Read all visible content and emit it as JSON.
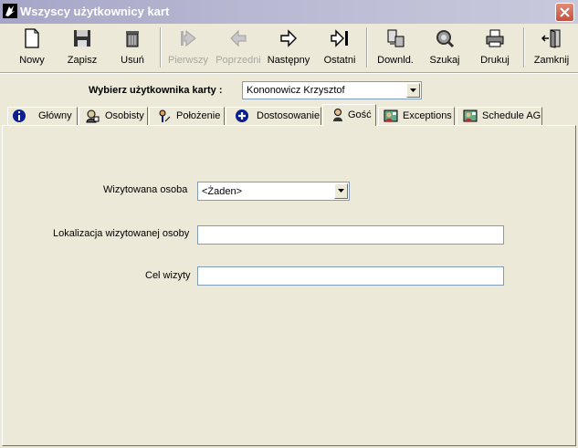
{
  "window": {
    "title": "Wszyscy użytkownicy kart"
  },
  "toolbar": {
    "items": [
      {
        "label": "Nowy",
        "icon": "new-document-icon",
        "enabled": true
      },
      {
        "label": "Zapisz",
        "icon": "floppy-disk-icon",
        "enabled": true
      },
      {
        "label": "Usuń",
        "icon": "trash-bin-icon",
        "enabled": true
      },
      {
        "label": "Pierwszy",
        "icon": "first-record-icon",
        "enabled": false
      },
      {
        "label": "Poprzedni",
        "icon": "previous-arrow-icon",
        "enabled": false
      },
      {
        "label": "Następny",
        "icon": "next-arrow-icon",
        "enabled": true
      },
      {
        "label": "Ostatni",
        "icon": "last-record-icon",
        "enabled": true
      },
      {
        "label": "Downld.",
        "icon": "download-icon",
        "enabled": true
      },
      {
        "label": "Szukaj",
        "icon": "search-icon",
        "enabled": true
      },
      {
        "label": "Drukuj",
        "icon": "printer-icon",
        "enabled": true
      },
      {
        "label": "Zamknij",
        "icon": "exit-door-icon",
        "enabled": true
      }
    ]
  },
  "selector": {
    "label": "Wybierz użytkownika karty :",
    "value": "Kononowicz Krzysztof"
  },
  "tabs": [
    {
      "label": "Główny",
      "icon": "info-icon"
    },
    {
      "label": "Osobisty",
      "icon": "personal-card-icon"
    },
    {
      "label": "Położenie",
      "icon": "location-icon"
    },
    {
      "label": "Dostosowanie",
      "icon": "plus-circle-icon"
    },
    {
      "label": "Gość",
      "icon": "guest-icon"
    },
    {
      "label": "Exceptions",
      "icon": "exceptions-icon"
    },
    {
      "label": "Schedule AG",
      "icon": "schedule-icon"
    }
  ],
  "active_tab": "Gość",
  "form": {
    "visited_person": {
      "label": "Wizytowana osoba",
      "value": "<Żaden>"
    },
    "visited_location": {
      "label": "Lokalizacja wizytowanej osoby",
      "value": ""
    },
    "visit_purpose": {
      "label": "Cel wizyty",
      "value": ""
    }
  },
  "colors": {
    "title_bar": "#b7b7d2",
    "face": "#ece9d8",
    "field_border": "#7f9db9"
  }
}
